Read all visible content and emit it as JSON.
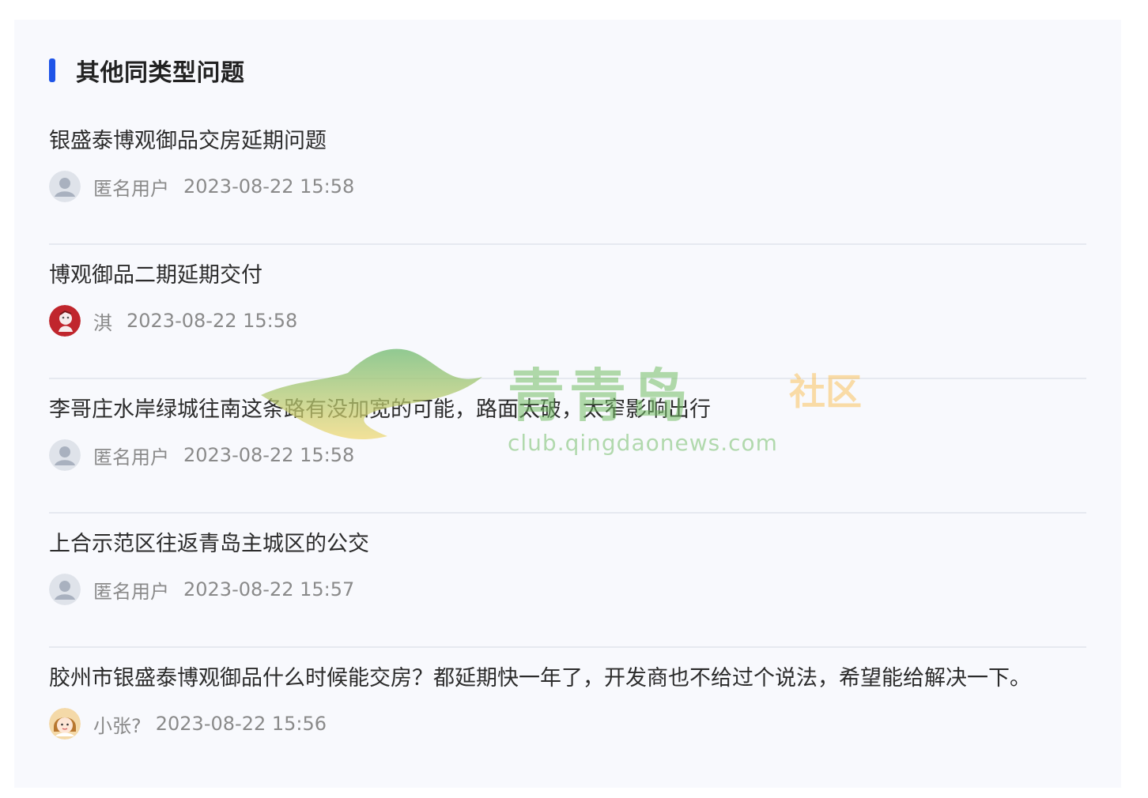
{
  "section": {
    "title": "其他同类型问题",
    "accent_color": "#1e54e8"
  },
  "questions": [
    {
      "title": "银盛泰博观御品交房延期问题",
      "user": "匿名用户",
      "time": "2023-08-22 15:58",
      "avatar": "default-user-avatar"
    },
    {
      "title": "博观御品二期延期交付",
      "user": "淇",
      "time": "2023-08-22 15:58",
      "avatar": "red-illustrated-avatar"
    },
    {
      "title": "李哥庄水岸绿城往南这条路有没加宽的可能，路面太破，太窄影响出行",
      "user": "匿名用户",
      "time": "2023-08-22 15:58",
      "avatar": "default-user-avatar"
    },
    {
      "title": "上合示范区往返青岛主城区的公交",
      "user": "匿名用户",
      "time": "2023-08-22 15:57",
      "avatar": "default-user-avatar"
    },
    {
      "title": "胶州市银盛泰博观御品什么时候能交房？都延期快一年了，开发商也不给过个说法，希望能给解决一下。",
      "user": "小张?",
      "time": "2023-08-22 15:56",
      "avatar": "girl-cartoon-avatar"
    }
  ],
  "watermark": {
    "brand": "青青岛",
    "tag": "社区",
    "url": "club.qingdaonews.com"
  }
}
